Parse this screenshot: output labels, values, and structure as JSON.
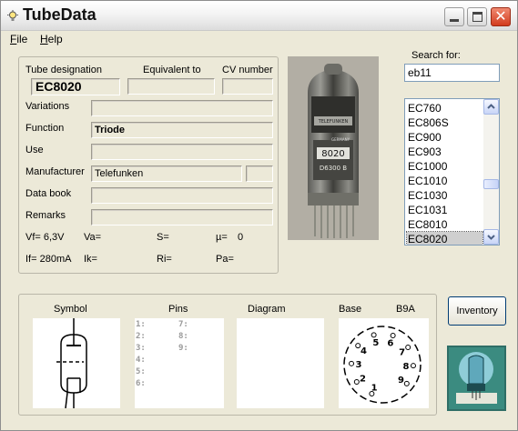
{
  "window": {
    "title": "TubeData"
  },
  "menu": {
    "file": "File",
    "help": "Help",
    "file_accel": "F",
    "file_rest": "ile",
    "help_accel": "H",
    "help_rest": "elp"
  },
  "details": {
    "tube_designation_label": "Tube designation",
    "equivalent_label": "Equivalent to",
    "cv_label": "CV number",
    "tube_designation": "EC8020",
    "equivalent": "",
    "cv_number": "",
    "variations_label": "Variations",
    "variations": "",
    "function_label": "Function",
    "function": "Triode",
    "use_label": "Use",
    "use": "",
    "manufacturer_label": "Manufacturer",
    "manufacturer": "Telefunken",
    "manufacturer_code": "",
    "databook_label": "Data book",
    "databook": "",
    "remarks_label": "Remarks",
    "remarks": "",
    "vf": "Vf= 6,3V",
    "va": "Va=",
    "s": "S=",
    "mu": "µ=",
    "mu_value": "0",
    "if": "If= 280mA",
    "ik": "Ik=",
    "ri": "Ri=",
    "pa": "Pa="
  },
  "photo": {
    "print_brand": "TELEFUNKEN",
    "print_country": "GERMANY",
    "print_type": "8020",
    "print_code": "D6300 B"
  },
  "search": {
    "label": "Search for:",
    "value": "eb11"
  },
  "tube_list": {
    "items": [
      "EC760",
      "EC806S",
      "EC900",
      "EC903",
      "EC1000",
      "EC1010",
      "EC1030",
      "EC1031",
      "EC8010",
      "EC8020"
    ],
    "selected": "EC8020"
  },
  "lower": {
    "symbol_label": "Symbol",
    "pins_label": "Pins",
    "diagram_label": "Diagram",
    "base_label": "Base",
    "base_value": "B9A",
    "pins_left": [
      "1:",
      "2:",
      "3:",
      "4:",
      "5:",
      "6:"
    ],
    "pins_right": [
      "7:",
      "8:",
      "9:"
    ],
    "base_pins": [
      "1",
      "2",
      "3",
      "4",
      "5",
      "6",
      "7",
      "8",
      "9"
    ]
  },
  "inventory": {
    "label": "Inventory"
  },
  "colors": {
    "selection": "#cfcfcf",
    "close_button": "#d23b1e",
    "list_border": "#7f9db9"
  }
}
